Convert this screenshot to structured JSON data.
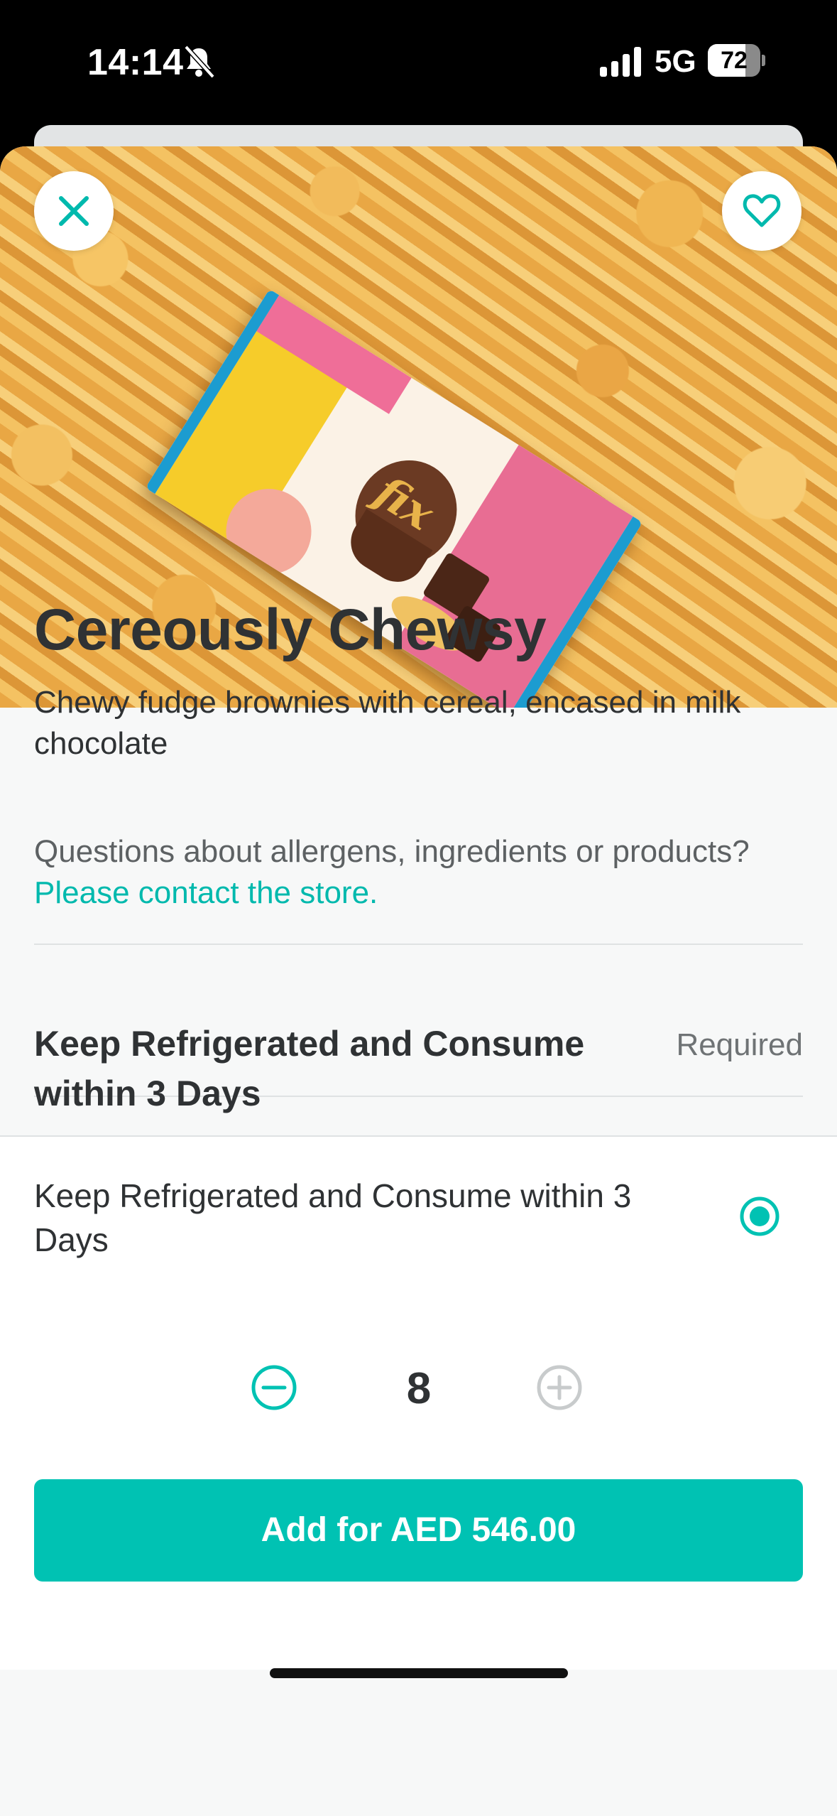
{
  "status_bar": {
    "time": "14:14",
    "network": "5G",
    "battery_percent": "72",
    "battery_level": 0.72,
    "icons": [
      "bell-slash-icon",
      "signal-icon"
    ]
  },
  "product": {
    "title": "Cereously Chewsy",
    "description": "Chewy fudge brownies with cereal, encased in milk chocolate",
    "image_icon": "chocolate-bar-image"
  },
  "allergens": {
    "question": "Questions about allergens, ingredients or products?",
    "link": "Please contact the store."
  },
  "option_group": {
    "title": "Keep Refrigerated and Consume within 3 Days",
    "required_label": "Required",
    "options": [
      {
        "label": "Keep Refrigerated and Consume within 3 Days",
        "selected": true
      }
    ]
  },
  "quantity": {
    "value": "8"
  },
  "cart": {
    "add_button": "Add for AED 546.00"
  },
  "colors": {
    "accent": "#00c2b3",
    "link": "#00b9ad",
    "text": "#2f3234"
  }
}
